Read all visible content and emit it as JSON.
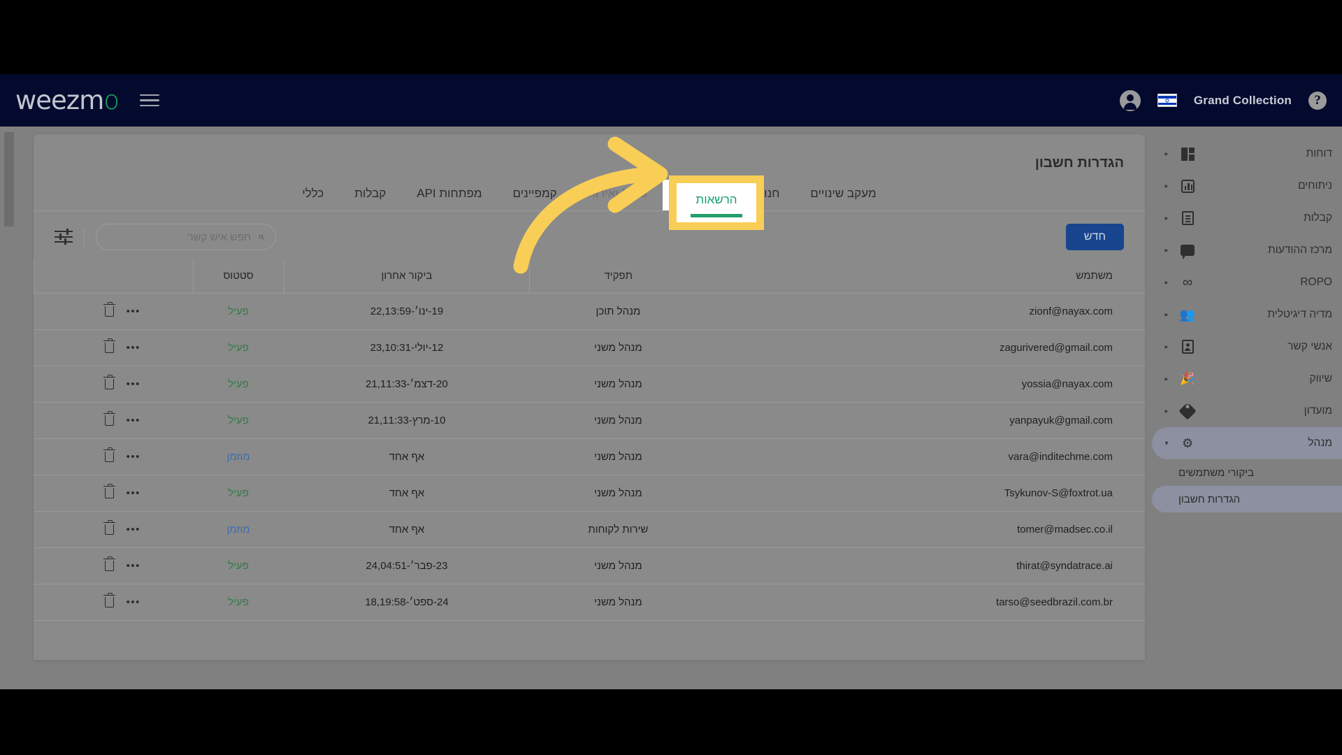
{
  "topbar": {
    "brand": "Grand Collection",
    "help_glyph": "?",
    "logo_text": "weezm",
    "logo_accent": "o",
    "accent_green": "#1aa860",
    "bg": "#040a2e",
    "icons": {
      "account": "account-circle-icon",
      "flag": "israel-flag-icon",
      "help": "help-circle-icon",
      "menu": "hamburger-menu-icon"
    }
  },
  "sidebar": {
    "items": [
      {
        "label": "דוחות",
        "icon": "dashboard-grid-icon",
        "caret": "▸"
      },
      {
        "label": "ניתוחים",
        "icon": "bar-chart-icon",
        "caret": "▸"
      },
      {
        "label": "קבלות",
        "icon": "receipt-icon",
        "caret": "▸"
      },
      {
        "label": "מרכז ההודעות",
        "icon": "chat-bubble-icon",
        "caret": "▸"
      },
      {
        "label": "ROPO",
        "icon": "infinity-icon",
        "caret": "▸"
      },
      {
        "label": "מדיה דיגיטלית",
        "icon": "people-group-icon",
        "caret": "▸"
      },
      {
        "label": "אנשי קשר",
        "icon": "contact-card-icon",
        "caret": "▸"
      },
      {
        "label": "שיווק",
        "icon": "megaphone-icon",
        "caret": "▸"
      },
      {
        "label": "מועדון",
        "icon": "tag-icon",
        "caret": "▸"
      },
      {
        "label": "מנהל",
        "icon": "gear-icon",
        "caret": "▾",
        "active": true
      }
    ],
    "sub_items": [
      {
        "label": "ביקורי משתמשים",
        "selected": false
      },
      {
        "label": "הגדרות חשבון",
        "selected": true
      }
    ]
  },
  "main": {
    "title": "הגדרות חשבון",
    "tabs": [
      {
        "label": "מעקב שינויים",
        "state": "normal"
      },
      {
        "label": "חנויות",
        "state": "normal"
      },
      {
        "label": "הרשאות",
        "state": "active"
      },
      {
        "label": "DNS ואירוח",
        "state": "muted"
      },
      {
        "label": "קמפיינים",
        "state": "normal"
      },
      {
        "label": "מפתחות API",
        "state": "normal"
      },
      {
        "label": "קבלות",
        "state": "normal"
      },
      {
        "label": "כללי",
        "state": "normal"
      }
    ],
    "toolbar": {
      "new_label": "חדש",
      "new_color": "#17458e",
      "search_placeholder": "חפש איש קשר",
      "search_value": "",
      "filter_icon": "sliders-filter-icon",
      "search_icon": "search-icon"
    },
    "table": {
      "headers": [
        "משתמש",
        "תפקיד",
        "ביקור אחרון",
        "סטטוס",
        ""
      ],
      "status_colors": {
        "פעיל": "#2e7d46",
        "מוזמן": "#3f6ea8"
      },
      "rows": [
        {
          "user": "zionf@nayax.com",
          "role": "מנהל תוכן",
          "last_visit": "19-ינו׳-22,13:59",
          "status": "פעיל",
          "status_kind": "active"
        },
        {
          "user": "zagurivered@gmail.com",
          "role": "מנהל משני",
          "last_visit": "12-יולי-23,10:31",
          "status": "פעיל",
          "status_kind": "active"
        },
        {
          "user": "yossia@nayax.com",
          "role": "מנהל משני",
          "last_visit": "20-דצמ׳-21,11:33",
          "status": "פעיל",
          "status_kind": "active"
        },
        {
          "user": "yanpayuk@gmail.com",
          "role": "מנהל משני",
          "last_visit": "10-מרץ-21,11:33",
          "status": "פעיל",
          "status_kind": "active"
        },
        {
          "user": "vara@inditechme.com",
          "role": "מנהל משני",
          "last_visit": "אף אחד",
          "status": "מוזמן",
          "status_kind": "invited"
        },
        {
          "user": "Tsykunov-S@foxtrot.ua",
          "role": "מנהל משני",
          "last_visit": "אף אחד",
          "status": "פעיל",
          "status_kind": "active"
        },
        {
          "user": "tomer@madsec.co.il",
          "role": "שירות לקוחות",
          "last_visit": "אף אחד",
          "status": "מוזמן",
          "status_kind": "invited"
        },
        {
          "user": "thirat@syndatrace.ai",
          "role": "מנהל משני",
          "last_visit": "23-פבר׳-24,04:51",
          "status": "פעיל",
          "status_kind": "active"
        },
        {
          "user": "tarso@seedbrazil.com.br",
          "role": "מנהל משני",
          "last_visit": "24-ספט׳-18,19:58",
          "status": "פעיל",
          "status_kind": "active"
        }
      ],
      "row_actions": {
        "more": "•••",
        "delete": "trash-icon"
      }
    }
  },
  "annotation": {
    "highlight_label": "הרשאות",
    "highlight_border_color": "#f9ce56",
    "arrow_color": "#f9ce56"
  }
}
